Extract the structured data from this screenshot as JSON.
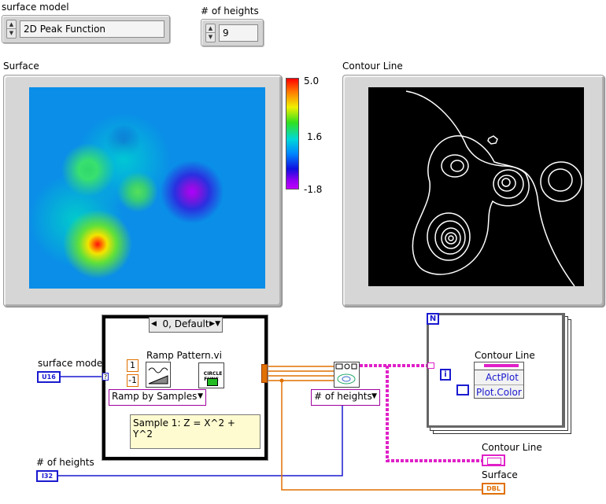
{
  "front_panel": {
    "surface_model": {
      "label": "surface model",
      "value": "2D Peak Function"
    },
    "num_heights": {
      "label": "# of heights",
      "value": "9"
    },
    "surface_graph": {
      "label": "Surface",
      "scale": {
        "max": "5.0",
        "mid": "1.6",
        "min": "-1.8"
      }
    },
    "contour_graph": {
      "label": "Contour Line"
    }
  },
  "block_diagram": {
    "case_selector": "0, Default",
    "ramp_vi_label": "Ramp Pattern.vi",
    "const_one": "1",
    "const_neg_one": "-1",
    "circle_func": "CIRCLE\nFUNC",
    "ramp_ring": "Ramp by Samples",
    "comment": "Sample 1: Z = X^2 + Y^2",
    "heights_ring": "# of heights",
    "terminal_surface_model_label": "surface model",
    "terminal_surface_model_type": "U16",
    "terminal_num_heights_label": "# of heights",
    "terminal_num_heights_type": "I32",
    "for_loop_n": "N",
    "for_loop_i": "i",
    "property_node_title": "Contour Line",
    "property_actplot": "ActPlot",
    "property_plot_color": "Plot.Color",
    "indicator_contour_label": "Contour Line",
    "indicator_surface_label": "Surface",
    "indicator_surface_type": "DBL"
  },
  "colors": {
    "wire_orange": "#e07000",
    "wire_blue": "#1a1ad0",
    "wire_pink": "#e020c8",
    "ramp_ring_border": "#a000a0"
  }
}
